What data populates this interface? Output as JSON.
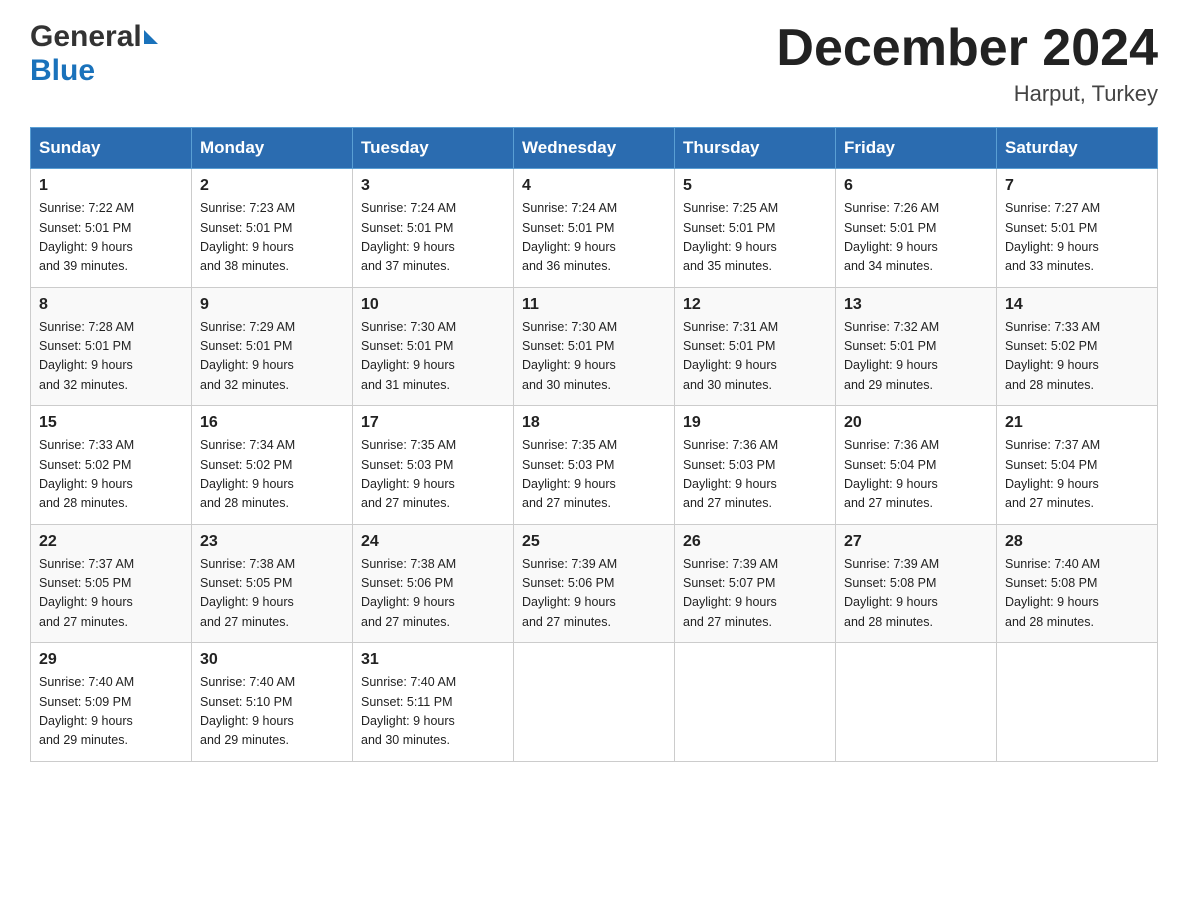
{
  "logo": {
    "general": "General",
    "blue": "Blue",
    "aria": "GeneralBlue logo"
  },
  "header": {
    "title": "December 2024",
    "subtitle": "Harput, Turkey"
  },
  "days_of_week": [
    "Sunday",
    "Monday",
    "Tuesday",
    "Wednesday",
    "Thursday",
    "Friday",
    "Saturday"
  ],
  "weeks": [
    [
      {
        "num": "1",
        "sunrise": "7:22 AM",
        "sunset": "5:01 PM",
        "daylight": "9 hours and 39 minutes."
      },
      {
        "num": "2",
        "sunrise": "7:23 AM",
        "sunset": "5:01 PM",
        "daylight": "9 hours and 38 minutes."
      },
      {
        "num": "3",
        "sunrise": "7:24 AM",
        "sunset": "5:01 PM",
        "daylight": "9 hours and 37 minutes."
      },
      {
        "num": "4",
        "sunrise": "7:24 AM",
        "sunset": "5:01 PM",
        "daylight": "9 hours and 36 minutes."
      },
      {
        "num": "5",
        "sunrise": "7:25 AM",
        "sunset": "5:01 PM",
        "daylight": "9 hours and 35 minutes."
      },
      {
        "num": "6",
        "sunrise": "7:26 AM",
        "sunset": "5:01 PM",
        "daylight": "9 hours and 34 minutes."
      },
      {
        "num": "7",
        "sunrise": "7:27 AM",
        "sunset": "5:01 PM",
        "daylight": "9 hours and 33 minutes."
      }
    ],
    [
      {
        "num": "8",
        "sunrise": "7:28 AM",
        "sunset": "5:01 PM",
        "daylight": "9 hours and 32 minutes."
      },
      {
        "num": "9",
        "sunrise": "7:29 AM",
        "sunset": "5:01 PM",
        "daylight": "9 hours and 32 minutes."
      },
      {
        "num": "10",
        "sunrise": "7:30 AM",
        "sunset": "5:01 PM",
        "daylight": "9 hours and 31 minutes."
      },
      {
        "num": "11",
        "sunrise": "7:30 AM",
        "sunset": "5:01 PM",
        "daylight": "9 hours and 30 minutes."
      },
      {
        "num": "12",
        "sunrise": "7:31 AM",
        "sunset": "5:01 PM",
        "daylight": "9 hours and 30 minutes."
      },
      {
        "num": "13",
        "sunrise": "7:32 AM",
        "sunset": "5:01 PM",
        "daylight": "9 hours and 29 minutes."
      },
      {
        "num": "14",
        "sunrise": "7:33 AM",
        "sunset": "5:02 PM",
        "daylight": "9 hours and 28 minutes."
      }
    ],
    [
      {
        "num": "15",
        "sunrise": "7:33 AM",
        "sunset": "5:02 PM",
        "daylight": "9 hours and 28 minutes."
      },
      {
        "num": "16",
        "sunrise": "7:34 AM",
        "sunset": "5:02 PM",
        "daylight": "9 hours and 28 minutes."
      },
      {
        "num": "17",
        "sunrise": "7:35 AM",
        "sunset": "5:03 PM",
        "daylight": "9 hours and 27 minutes."
      },
      {
        "num": "18",
        "sunrise": "7:35 AM",
        "sunset": "5:03 PM",
        "daylight": "9 hours and 27 minutes."
      },
      {
        "num": "19",
        "sunrise": "7:36 AM",
        "sunset": "5:03 PM",
        "daylight": "9 hours and 27 minutes."
      },
      {
        "num": "20",
        "sunrise": "7:36 AM",
        "sunset": "5:04 PM",
        "daylight": "9 hours and 27 minutes."
      },
      {
        "num": "21",
        "sunrise": "7:37 AM",
        "sunset": "5:04 PM",
        "daylight": "9 hours and 27 minutes."
      }
    ],
    [
      {
        "num": "22",
        "sunrise": "7:37 AM",
        "sunset": "5:05 PM",
        "daylight": "9 hours and 27 minutes."
      },
      {
        "num": "23",
        "sunrise": "7:38 AM",
        "sunset": "5:05 PM",
        "daylight": "9 hours and 27 minutes."
      },
      {
        "num": "24",
        "sunrise": "7:38 AM",
        "sunset": "5:06 PM",
        "daylight": "9 hours and 27 minutes."
      },
      {
        "num": "25",
        "sunrise": "7:39 AM",
        "sunset": "5:06 PM",
        "daylight": "9 hours and 27 minutes."
      },
      {
        "num": "26",
        "sunrise": "7:39 AM",
        "sunset": "5:07 PM",
        "daylight": "9 hours and 27 minutes."
      },
      {
        "num": "27",
        "sunrise": "7:39 AM",
        "sunset": "5:08 PM",
        "daylight": "9 hours and 28 minutes."
      },
      {
        "num": "28",
        "sunrise": "7:40 AM",
        "sunset": "5:08 PM",
        "daylight": "9 hours and 28 minutes."
      }
    ],
    [
      {
        "num": "29",
        "sunrise": "7:40 AM",
        "sunset": "5:09 PM",
        "daylight": "9 hours and 29 minutes."
      },
      {
        "num": "30",
        "sunrise": "7:40 AM",
        "sunset": "5:10 PM",
        "daylight": "9 hours and 29 minutes."
      },
      {
        "num": "31",
        "sunrise": "7:40 AM",
        "sunset": "5:11 PM",
        "daylight": "9 hours and 30 minutes."
      },
      null,
      null,
      null,
      null
    ]
  ],
  "labels": {
    "sunrise": "Sunrise:",
    "sunset": "Sunset:",
    "daylight": "Daylight:"
  }
}
